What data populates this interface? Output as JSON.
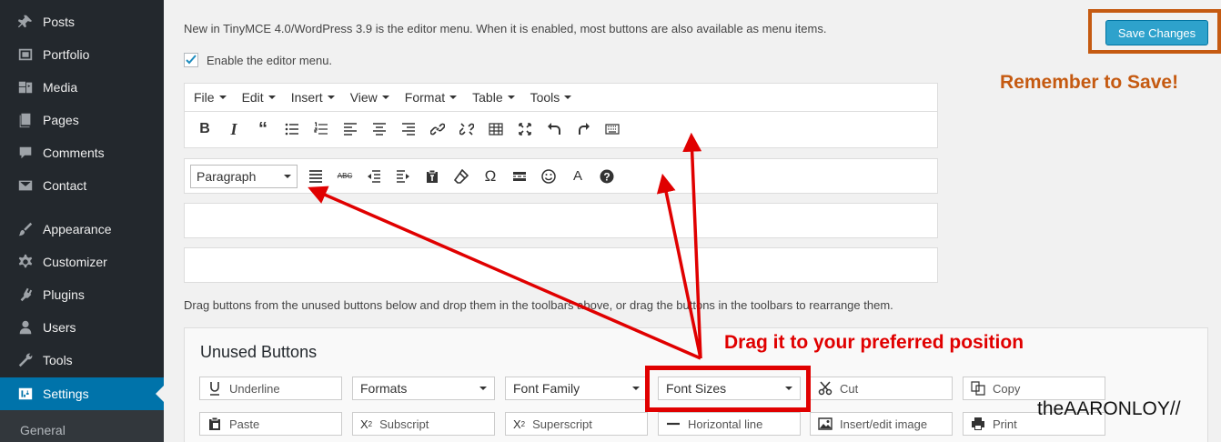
{
  "sidebar": {
    "items": [
      {
        "label": "Posts",
        "icon": "pushpin-icon"
      },
      {
        "label": "Portfolio",
        "icon": "portfolio-icon"
      },
      {
        "label": "Media",
        "icon": "media-icon"
      },
      {
        "label": "Pages",
        "icon": "pages-icon"
      },
      {
        "label": "Comments",
        "icon": "comment-icon"
      },
      {
        "label": "Contact",
        "icon": "envelope-icon"
      },
      {
        "label": "Appearance",
        "icon": "paintbrush-icon"
      },
      {
        "label": "Customizer",
        "icon": "gear-icon"
      },
      {
        "label": "Plugins",
        "icon": "plugin-icon"
      },
      {
        "label": "Users",
        "icon": "user-icon"
      },
      {
        "label": "Tools",
        "icon": "wrench-icon"
      },
      {
        "label": "Settings",
        "icon": "settings-icon",
        "current": true
      }
    ],
    "submenu": {
      "general": "General"
    }
  },
  "main": {
    "intro": "New in TinyMCE 4.0/WordPress 3.9 is the editor menu. When it is enabled, most buttons are also available as menu items.",
    "enable_menu_label": "Enable the editor menu.",
    "enable_menu_checked": true,
    "menubar": [
      "File",
      "Edit",
      "Insert",
      "View",
      "Format",
      "Table",
      "Tools"
    ],
    "toolbar1_icons": [
      "bold-icon",
      "italic-icon",
      "blockquote-icon",
      "bullet-list-icon",
      "numbered-list-icon",
      "align-left-icon",
      "align-center-icon",
      "align-right-icon",
      "link-icon",
      "unlink-icon",
      "table-icon",
      "fullscreen-icon",
      "undo-icon",
      "redo-icon",
      "keyboard-icon"
    ],
    "toolbar2": {
      "format_select": "Paragraph",
      "icons": [
        "justify-icon",
        "strikethrough-icon",
        "outdent-icon",
        "indent-icon",
        "paste-text-icon",
        "clear-formatting-icon",
        "omega-icon",
        "read-more-icon",
        "emoticon-icon",
        "text-color-icon",
        "help-icon"
      ]
    },
    "drag_info": "Drag buttons from the unused buttons below and drop them in the toolbars above, or drag the buttons in the toolbars to rearrange them.",
    "unused_title": "Unused Buttons",
    "unused_row1": [
      {
        "label": "Underline",
        "icon": "underline-icon"
      },
      {
        "label": "Formats",
        "select": true
      },
      {
        "label": "Font Family",
        "select": true
      },
      {
        "label": "Font Sizes",
        "select": true
      },
      {
        "label": "Cut",
        "icon": "scissors-icon"
      },
      {
        "label": "Copy",
        "icon": "copy-icon"
      }
    ],
    "unused_row2": [
      {
        "label": "Paste",
        "icon": "paste-icon"
      },
      {
        "label": "Subscript",
        "icon": "subscript-icon"
      },
      {
        "label": "Superscript",
        "icon": "superscript-icon"
      },
      {
        "label": "Horizontal line",
        "icon": "horizontal-line-icon"
      },
      {
        "label": "Insert/edit image",
        "icon": "image-icon"
      },
      {
        "label": "Print",
        "icon": "printer-icon"
      }
    ],
    "save_label": "Save Changes"
  },
  "annotations": {
    "remember": "Remember to Save!",
    "drag_callout": "Drag it to your preferred position",
    "watermark": "theAARONLOY//",
    "orange": "#c55a11",
    "red": "#e00000"
  }
}
